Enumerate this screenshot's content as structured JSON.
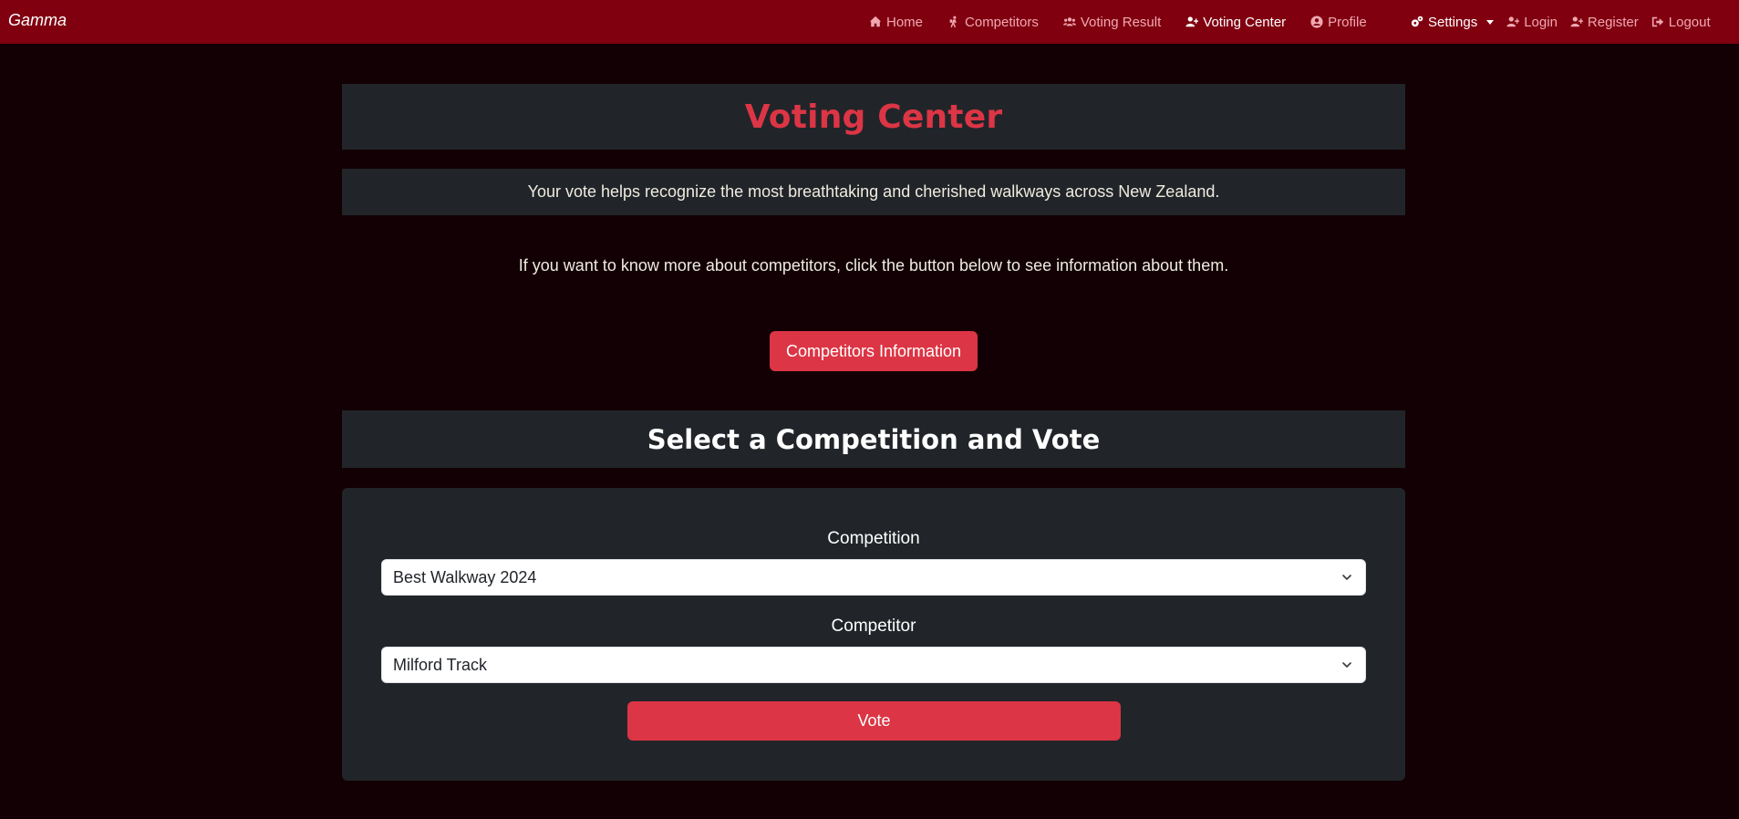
{
  "brand": "Gamma",
  "nav": {
    "home": "Home",
    "competitors": "Competitors",
    "voting_result": "Voting Result",
    "voting_center": "Voting Center",
    "profile": "Profile",
    "settings": "Settings",
    "login": "Login",
    "register": "Register",
    "logout": "Logout"
  },
  "page": {
    "title": "Voting Center",
    "intro": "Your vote helps recognize the most breathtaking and cherished walkways across New Zealand.",
    "info": "If you want to know more about competitors, click the button below to see information about them.",
    "competitors_button": "Competitors Information",
    "section_title": "Select a Competition and Vote"
  },
  "form": {
    "competition_label": "Competition",
    "competition_value": "Best Walkway 2024",
    "competitor_label": "Competitor",
    "competitor_value": "Milford Track",
    "vote_button": "Vote"
  },
  "colors": {
    "navbar": "#800010",
    "background": "#120004",
    "accent": "#dc3545",
    "panel": "#212529"
  }
}
